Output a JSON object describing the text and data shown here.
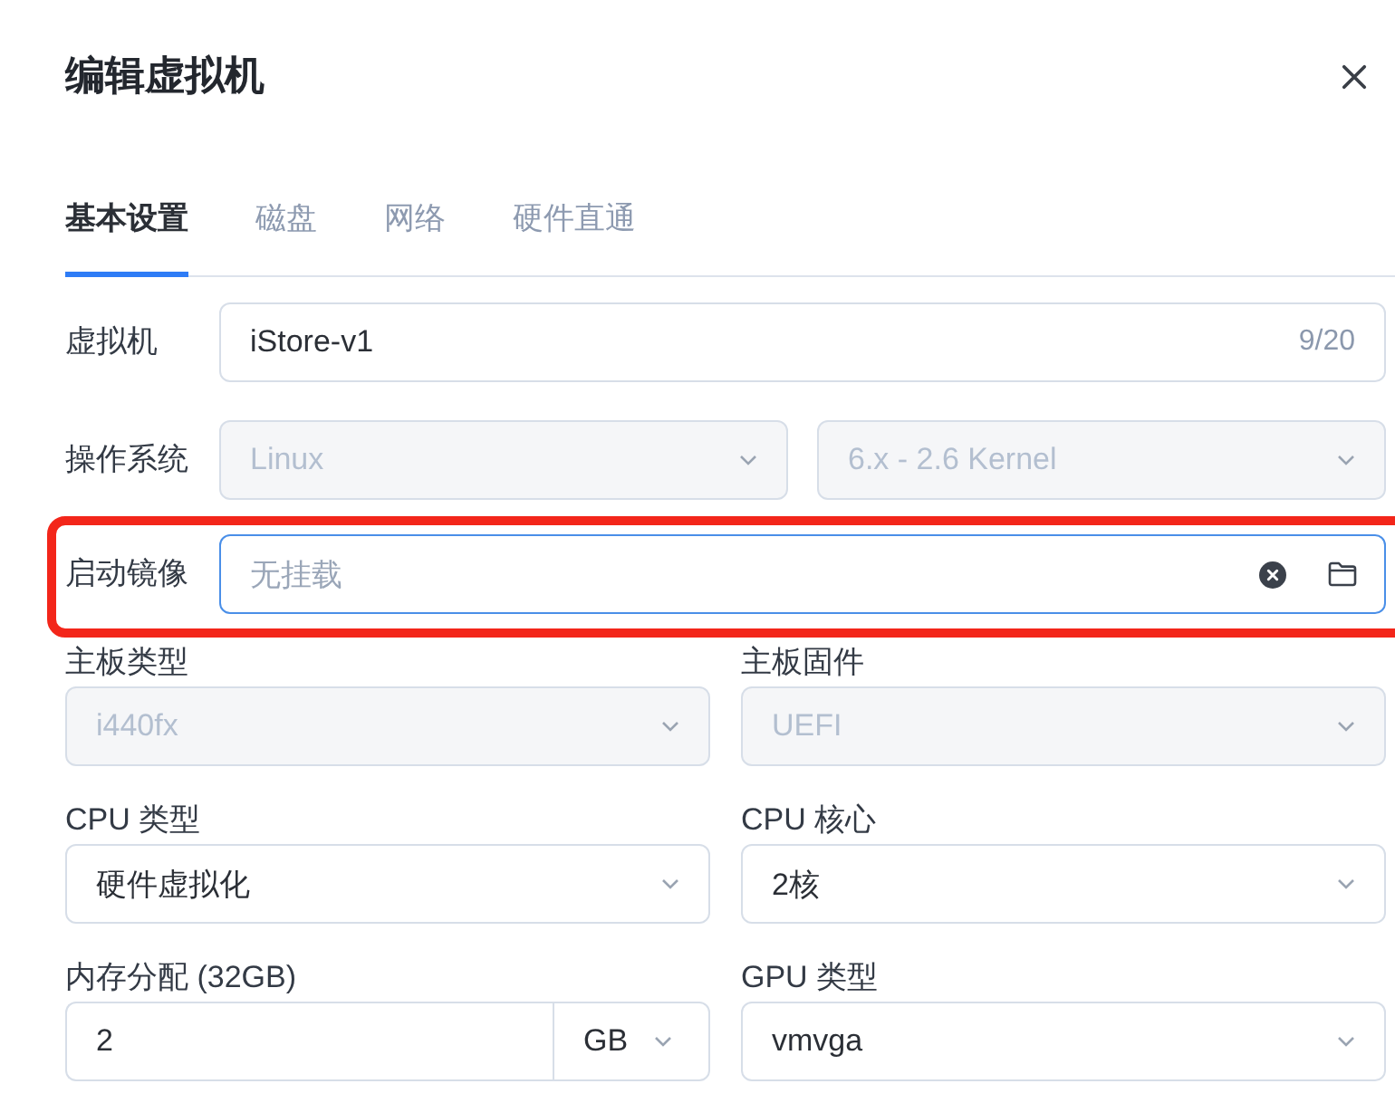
{
  "dialog": {
    "title": "编辑虚拟机"
  },
  "tabs": [
    {
      "label": "基本设置",
      "selected": true
    },
    {
      "label": "磁盘",
      "selected": false
    },
    {
      "label": "网络",
      "selected": false
    },
    {
      "label": "硬件直通",
      "selected": false
    }
  ],
  "fields": [
    {
      "kind": "text",
      "label": "虚拟机",
      "value": "iStore-v1",
      "counter": "9/20"
    },
    {
      "kind": "select_pair",
      "label": "操作系统",
      "selects": [
        {
          "value": "Linux",
          "disabled": true
        },
        {
          "value": "6.x - 2.6 Kernel",
          "disabled": true
        }
      ]
    },
    {
      "kind": "file",
      "label": "启动镜像",
      "placeholder": "无挂载",
      "focused": true,
      "highlighted": true
    }
  ],
  "grid": [
    {
      "kind": "select",
      "label": "主板类型",
      "value": "i440fx",
      "disabled": true
    },
    {
      "kind": "select",
      "label": "主板固件",
      "value": "UEFI",
      "disabled": true
    },
    {
      "kind": "select",
      "label": "CPU 类型",
      "value": "硬件虚拟化",
      "disabled": false
    },
    {
      "kind": "select",
      "label": "CPU 核心",
      "value": "2核",
      "disabled": false
    },
    {
      "kind": "number_unit",
      "label": "内存分配 (32GB)",
      "value": "2",
      "unit": "GB"
    },
    {
      "kind": "select",
      "label": "GPU 类型",
      "value": "vmvga",
      "disabled": false
    }
  ]
}
